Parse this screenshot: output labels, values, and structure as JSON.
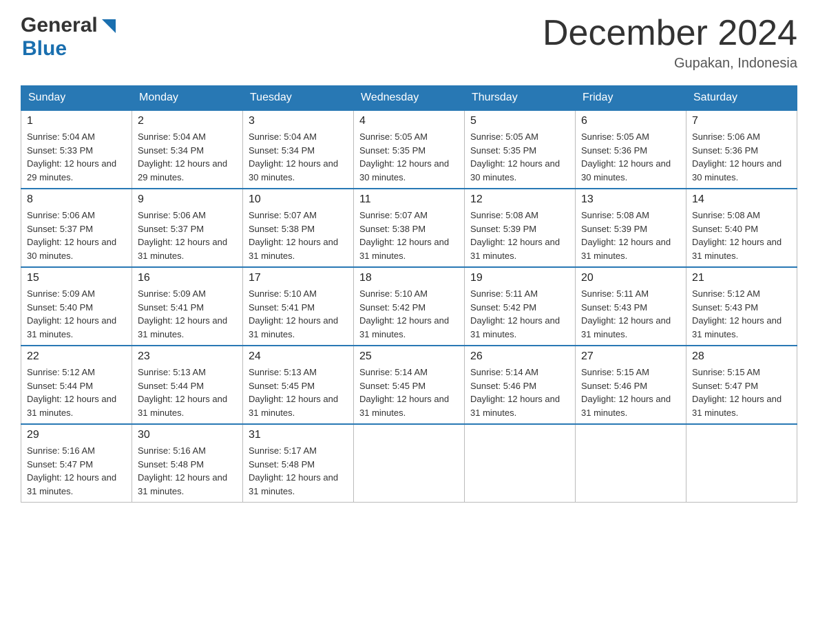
{
  "header": {
    "logo_general": "General",
    "logo_blue": "Blue",
    "month_title": "December 2024",
    "location": "Gupakan, Indonesia"
  },
  "days_of_week": [
    "Sunday",
    "Monday",
    "Tuesday",
    "Wednesday",
    "Thursday",
    "Friday",
    "Saturday"
  ],
  "weeks": [
    [
      {
        "day": "1",
        "sunrise": "Sunrise: 5:04 AM",
        "sunset": "Sunset: 5:33 PM",
        "daylight": "Daylight: 12 hours and 29 minutes."
      },
      {
        "day": "2",
        "sunrise": "Sunrise: 5:04 AM",
        "sunset": "Sunset: 5:34 PM",
        "daylight": "Daylight: 12 hours and 29 minutes."
      },
      {
        "day": "3",
        "sunrise": "Sunrise: 5:04 AM",
        "sunset": "Sunset: 5:34 PM",
        "daylight": "Daylight: 12 hours and 30 minutes."
      },
      {
        "day": "4",
        "sunrise": "Sunrise: 5:05 AM",
        "sunset": "Sunset: 5:35 PM",
        "daylight": "Daylight: 12 hours and 30 minutes."
      },
      {
        "day": "5",
        "sunrise": "Sunrise: 5:05 AM",
        "sunset": "Sunset: 5:35 PM",
        "daylight": "Daylight: 12 hours and 30 minutes."
      },
      {
        "day": "6",
        "sunrise": "Sunrise: 5:05 AM",
        "sunset": "Sunset: 5:36 PM",
        "daylight": "Daylight: 12 hours and 30 minutes."
      },
      {
        "day": "7",
        "sunrise": "Sunrise: 5:06 AM",
        "sunset": "Sunset: 5:36 PM",
        "daylight": "Daylight: 12 hours and 30 minutes."
      }
    ],
    [
      {
        "day": "8",
        "sunrise": "Sunrise: 5:06 AM",
        "sunset": "Sunset: 5:37 PM",
        "daylight": "Daylight: 12 hours and 30 minutes."
      },
      {
        "day": "9",
        "sunrise": "Sunrise: 5:06 AM",
        "sunset": "Sunset: 5:37 PM",
        "daylight": "Daylight: 12 hours and 31 minutes."
      },
      {
        "day": "10",
        "sunrise": "Sunrise: 5:07 AM",
        "sunset": "Sunset: 5:38 PM",
        "daylight": "Daylight: 12 hours and 31 minutes."
      },
      {
        "day": "11",
        "sunrise": "Sunrise: 5:07 AM",
        "sunset": "Sunset: 5:38 PM",
        "daylight": "Daylight: 12 hours and 31 minutes."
      },
      {
        "day": "12",
        "sunrise": "Sunrise: 5:08 AM",
        "sunset": "Sunset: 5:39 PM",
        "daylight": "Daylight: 12 hours and 31 minutes."
      },
      {
        "day": "13",
        "sunrise": "Sunrise: 5:08 AM",
        "sunset": "Sunset: 5:39 PM",
        "daylight": "Daylight: 12 hours and 31 minutes."
      },
      {
        "day": "14",
        "sunrise": "Sunrise: 5:08 AM",
        "sunset": "Sunset: 5:40 PM",
        "daylight": "Daylight: 12 hours and 31 minutes."
      }
    ],
    [
      {
        "day": "15",
        "sunrise": "Sunrise: 5:09 AM",
        "sunset": "Sunset: 5:40 PM",
        "daylight": "Daylight: 12 hours and 31 minutes."
      },
      {
        "day": "16",
        "sunrise": "Sunrise: 5:09 AM",
        "sunset": "Sunset: 5:41 PM",
        "daylight": "Daylight: 12 hours and 31 minutes."
      },
      {
        "day": "17",
        "sunrise": "Sunrise: 5:10 AM",
        "sunset": "Sunset: 5:41 PM",
        "daylight": "Daylight: 12 hours and 31 minutes."
      },
      {
        "day": "18",
        "sunrise": "Sunrise: 5:10 AM",
        "sunset": "Sunset: 5:42 PM",
        "daylight": "Daylight: 12 hours and 31 minutes."
      },
      {
        "day": "19",
        "sunrise": "Sunrise: 5:11 AM",
        "sunset": "Sunset: 5:42 PM",
        "daylight": "Daylight: 12 hours and 31 minutes."
      },
      {
        "day": "20",
        "sunrise": "Sunrise: 5:11 AM",
        "sunset": "Sunset: 5:43 PM",
        "daylight": "Daylight: 12 hours and 31 minutes."
      },
      {
        "day": "21",
        "sunrise": "Sunrise: 5:12 AM",
        "sunset": "Sunset: 5:43 PM",
        "daylight": "Daylight: 12 hours and 31 minutes."
      }
    ],
    [
      {
        "day": "22",
        "sunrise": "Sunrise: 5:12 AM",
        "sunset": "Sunset: 5:44 PM",
        "daylight": "Daylight: 12 hours and 31 minutes."
      },
      {
        "day": "23",
        "sunrise": "Sunrise: 5:13 AM",
        "sunset": "Sunset: 5:44 PM",
        "daylight": "Daylight: 12 hours and 31 minutes."
      },
      {
        "day": "24",
        "sunrise": "Sunrise: 5:13 AM",
        "sunset": "Sunset: 5:45 PM",
        "daylight": "Daylight: 12 hours and 31 minutes."
      },
      {
        "day": "25",
        "sunrise": "Sunrise: 5:14 AM",
        "sunset": "Sunset: 5:45 PM",
        "daylight": "Daylight: 12 hours and 31 minutes."
      },
      {
        "day": "26",
        "sunrise": "Sunrise: 5:14 AM",
        "sunset": "Sunset: 5:46 PM",
        "daylight": "Daylight: 12 hours and 31 minutes."
      },
      {
        "day": "27",
        "sunrise": "Sunrise: 5:15 AM",
        "sunset": "Sunset: 5:46 PM",
        "daylight": "Daylight: 12 hours and 31 minutes."
      },
      {
        "day": "28",
        "sunrise": "Sunrise: 5:15 AM",
        "sunset": "Sunset: 5:47 PM",
        "daylight": "Daylight: 12 hours and 31 minutes."
      }
    ],
    [
      {
        "day": "29",
        "sunrise": "Sunrise: 5:16 AM",
        "sunset": "Sunset: 5:47 PM",
        "daylight": "Daylight: 12 hours and 31 minutes."
      },
      {
        "day": "30",
        "sunrise": "Sunrise: 5:16 AM",
        "sunset": "Sunset: 5:48 PM",
        "daylight": "Daylight: 12 hours and 31 minutes."
      },
      {
        "day": "31",
        "sunrise": "Sunrise: 5:17 AM",
        "sunset": "Sunset: 5:48 PM",
        "daylight": "Daylight: 12 hours and 31 minutes."
      },
      null,
      null,
      null,
      null
    ]
  ]
}
